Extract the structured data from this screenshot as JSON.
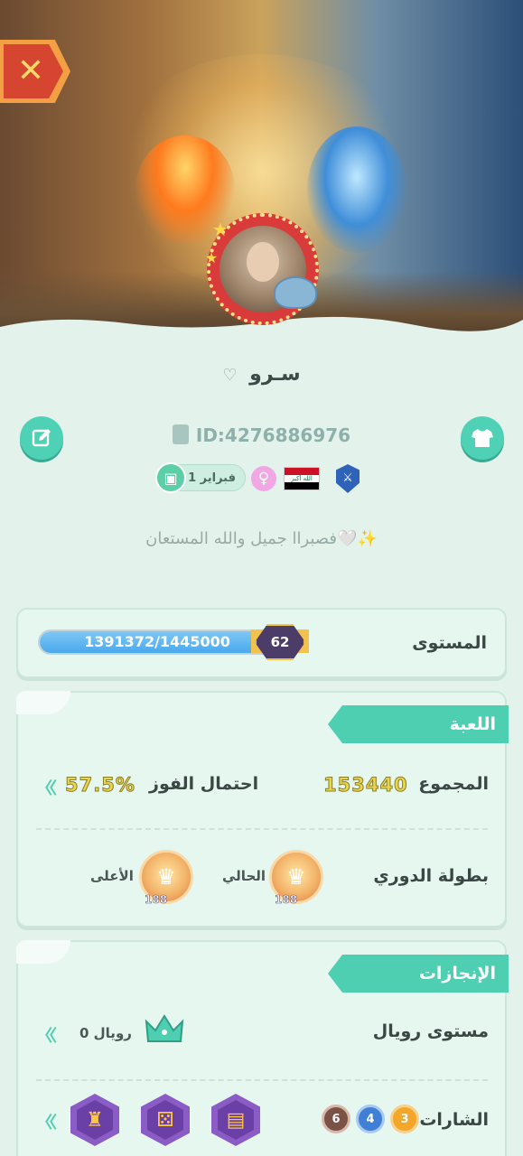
{
  "header": {
    "close_icon": "close-icon"
  },
  "profile": {
    "name": "سـرو",
    "name_heart": "♡",
    "id_text": "ID:4276886976",
    "birthday": "1 فبراير",
    "country": "Iraq",
    "flag_text": "الله أكبر",
    "bio": "فصبراا جميل والله المستعان🤍✨"
  },
  "level": {
    "label": "المستوى",
    "progress_text": "1391372/1445000",
    "current": 1391372,
    "max": 1445000,
    "badge": "62"
  },
  "game": {
    "section_title": "اللعبة",
    "total_label": "المجموع",
    "total_value": "153440",
    "win_label": "احتمال الفوز",
    "win_value": "57.5%",
    "league_label": "بطولة الدوري",
    "current_label": "الحالي",
    "highest_label": "الأعلى",
    "current_count": "188",
    "highest_count": "188"
  },
  "achievements": {
    "section_title": "الإنجازات",
    "royal_label": "مستوى رويال",
    "royal_value": "رويال 0",
    "badges_label": "الشارات",
    "badge_counts": [
      "3",
      "4",
      "6"
    ]
  },
  "colors": {
    "accent": "#4fcfb1",
    "background": "#e3f3ec",
    "progress": "#4aa9ec"
  }
}
